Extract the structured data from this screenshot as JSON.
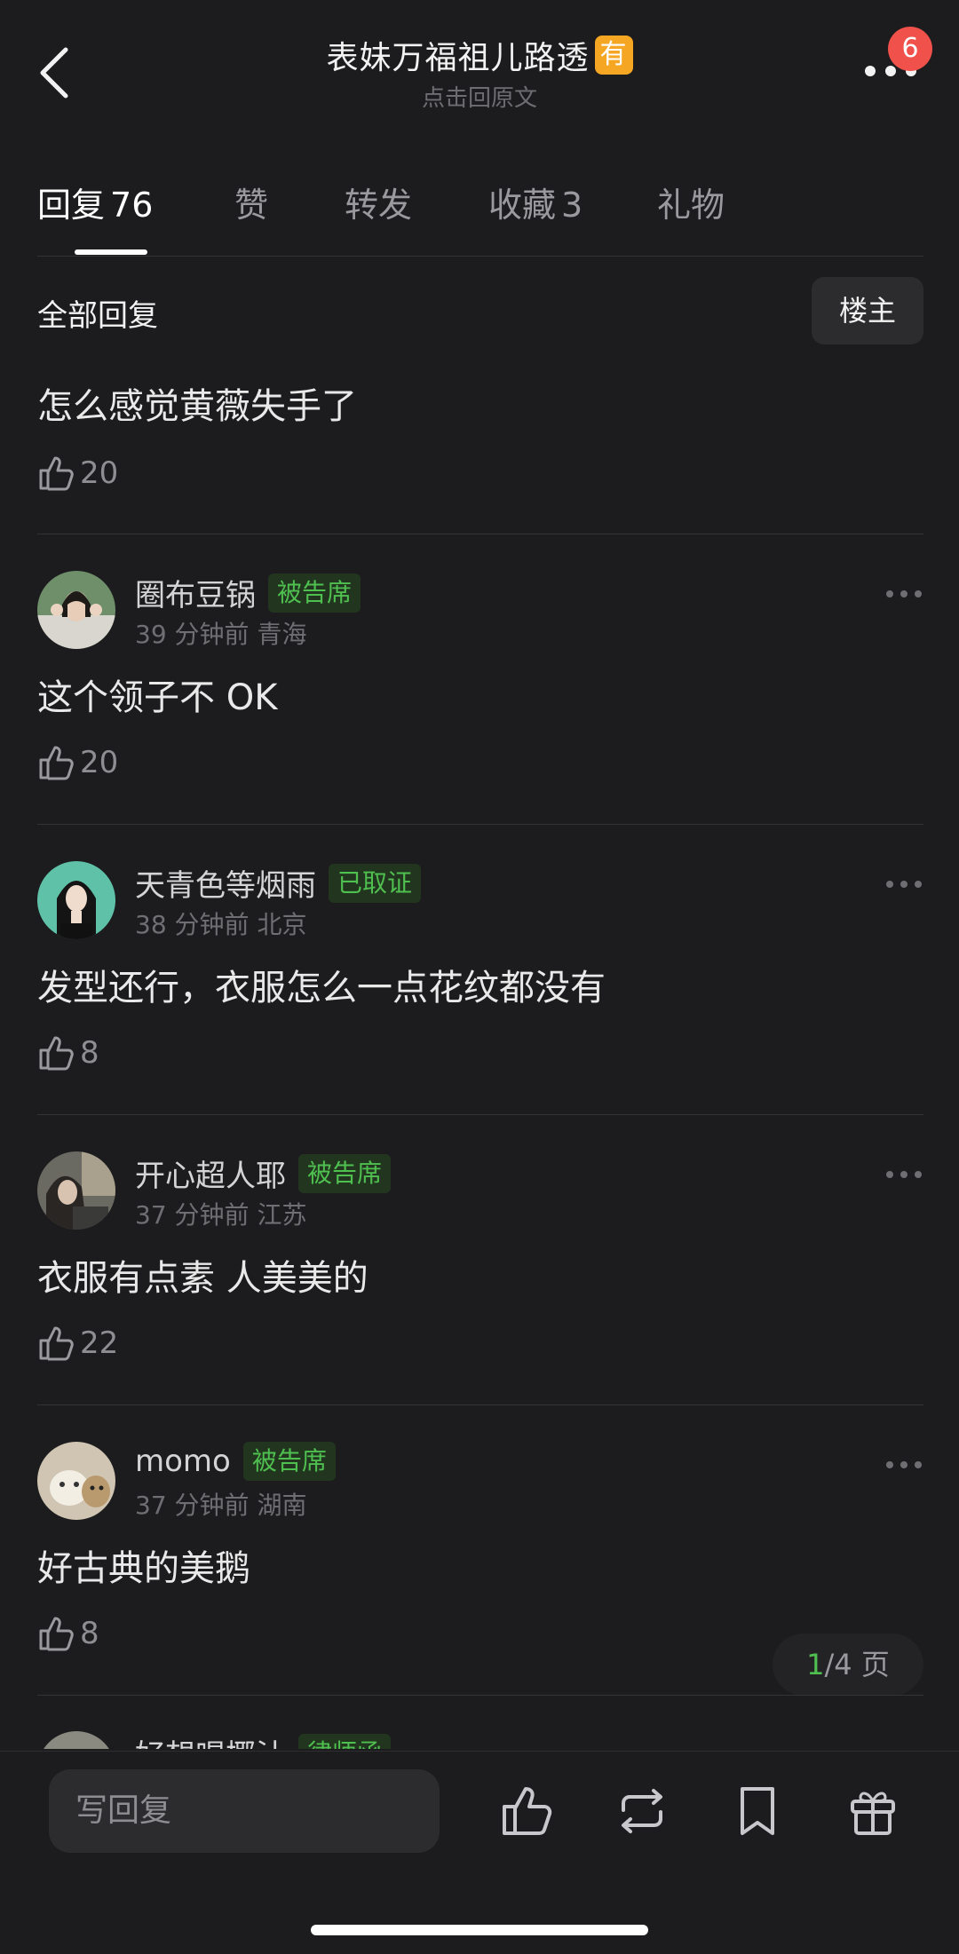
{
  "header": {
    "title": "表妹万福祖儿路透",
    "title_badge": "有",
    "subtitle": "点击回原文",
    "notification_count": "6"
  },
  "tabs": [
    {
      "label": "回复",
      "count": "76",
      "active": true
    },
    {
      "label": "赞",
      "count": ""
    },
    {
      "label": "转发",
      "count": ""
    },
    {
      "label": "收藏",
      "count": "3"
    },
    {
      "label": "礼物",
      "count": ""
    }
  ],
  "section": {
    "title": "全部回复",
    "owner_button": "楼主"
  },
  "first_comment": {
    "text": "怎么感觉黄薇失手了",
    "likes": "20"
  },
  "comments": [
    {
      "user": "圈布豆锅",
      "tag": "被告席",
      "time": "39 分钟前",
      "location": "青海",
      "text": "这个领子不 OK",
      "likes": "20"
    },
    {
      "user": "天青色等烟雨",
      "tag": "已取证",
      "time": "38 分钟前",
      "location": "北京",
      "text": "发型还行，衣服怎么一点花纹都没有",
      "likes": "8"
    },
    {
      "user": "开心超人耶",
      "tag": "被告席",
      "time": "37 分钟前",
      "location": "江苏",
      "text": "衣服有点素 人美美的",
      "likes": "22"
    },
    {
      "user": "momo",
      "tag": "被告席",
      "time": "37 分钟前",
      "location": "湖南",
      "text": "好古典的美鹅",
      "likes": "8"
    }
  ],
  "partial_comment": {
    "user": "好想喝椰汁",
    "tag": "律师函"
  },
  "pager": {
    "current": "1",
    "total": "/4 页"
  },
  "bottom_bar": {
    "reply_placeholder": "写回复"
  },
  "colors": {
    "background": "#1c1c1e",
    "tag_green": "#4fbf4f",
    "badge_red": "#f0514a",
    "title_badge_orange": "#f5a623"
  }
}
